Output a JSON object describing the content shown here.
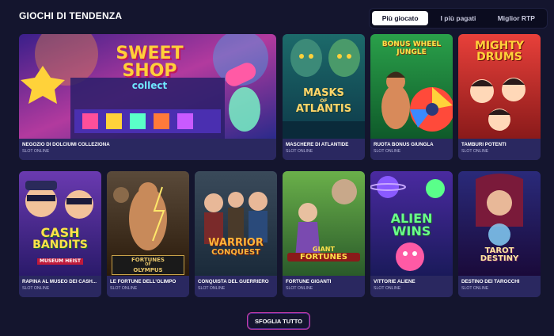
{
  "section": {
    "title": "GIOCHI DI TENDENZA",
    "tabs": [
      {
        "label": "Più giocato",
        "active": true
      },
      {
        "label": "I più pagati",
        "active": false
      },
      {
        "label": "Miglior RTP",
        "active": false
      }
    ]
  },
  "games": [
    {
      "name": "NEGOZIO DI DOLCIUMI COLLEZIONA",
      "category": "SLOT ONLINE",
      "logo_lines": [
        "SWEET",
        "SHOP"
      ],
      "logo_sub": "collect"
    },
    {
      "name": "MASCHERE DI ATLANTIDE",
      "category": "SLOT ONLINE",
      "logo_lines": [
        "MASKS",
        "ATLANTIS"
      ],
      "logo_sub": "OF"
    },
    {
      "name": "RUOTA BONUS GIUNGLA",
      "category": "SLOT ONLINE",
      "logo_lines": [
        "BONUS WHEEL",
        "JUNGLE"
      ],
      "logo_sub": ""
    },
    {
      "name": "TAMBURI POTENTI",
      "category": "SLOT ONLINE",
      "logo_lines": [
        "MIGHTY",
        "DRUMS"
      ],
      "logo_sub": ""
    },
    {
      "name": "RAPINA AL MUSEO DEI CASH...",
      "category": "SLOT ONLINE",
      "logo_lines": [
        "CASH",
        "BANDITS"
      ],
      "logo_sub": "MUSEUM HEIST"
    },
    {
      "name": "LE FORTUNE DELL'OLIMPO",
      "category": "SLOT ONLINE",
      "logo_lines": [
        "FORTUNES",
        "OLYMPUS"
      ],
      "logo_sub": "OF"
    },
    {
      "name": "CONQUISTA DEL GUERRIERO",
      "category": "SLOT ONLINE",
      "logo_lines": [
        "WARRIOR",
        "CONQUEST"
      ],
      "logo_sub": ""
    },
    {
      "name": "FORTUNE GIGANTI",
      "category": "SLOT ONLINE",
      "logo_lines": [
        "GIANT",
        "FORTUNES"
      ],
      "logo_sub": ""
    },
    {
      "name": "VITTORIE ALIENE",
      "category": "SLOT ONLINE",
      "logo_lines": [
        "ALIEN",
        "WINS"
      ],
      "logo_sub": ""
    },
    {
      "name": "DESTINO DEI TAROCCHI",
      "category": "SLOT ONLINE",
      "logo_lines": [
        "TAROT",
        "DESTINY"
      ],
      "logo_sub": ""
    }
  ],
  "browse_label": "SFOGLIA TUTTO",
  "colors": {
    "background": "#14152e",
    "card_info": "#2a2860",
    "accent_border": "#c93ca6",
    "tab_active_bg": "#ffffff"
  }
}
